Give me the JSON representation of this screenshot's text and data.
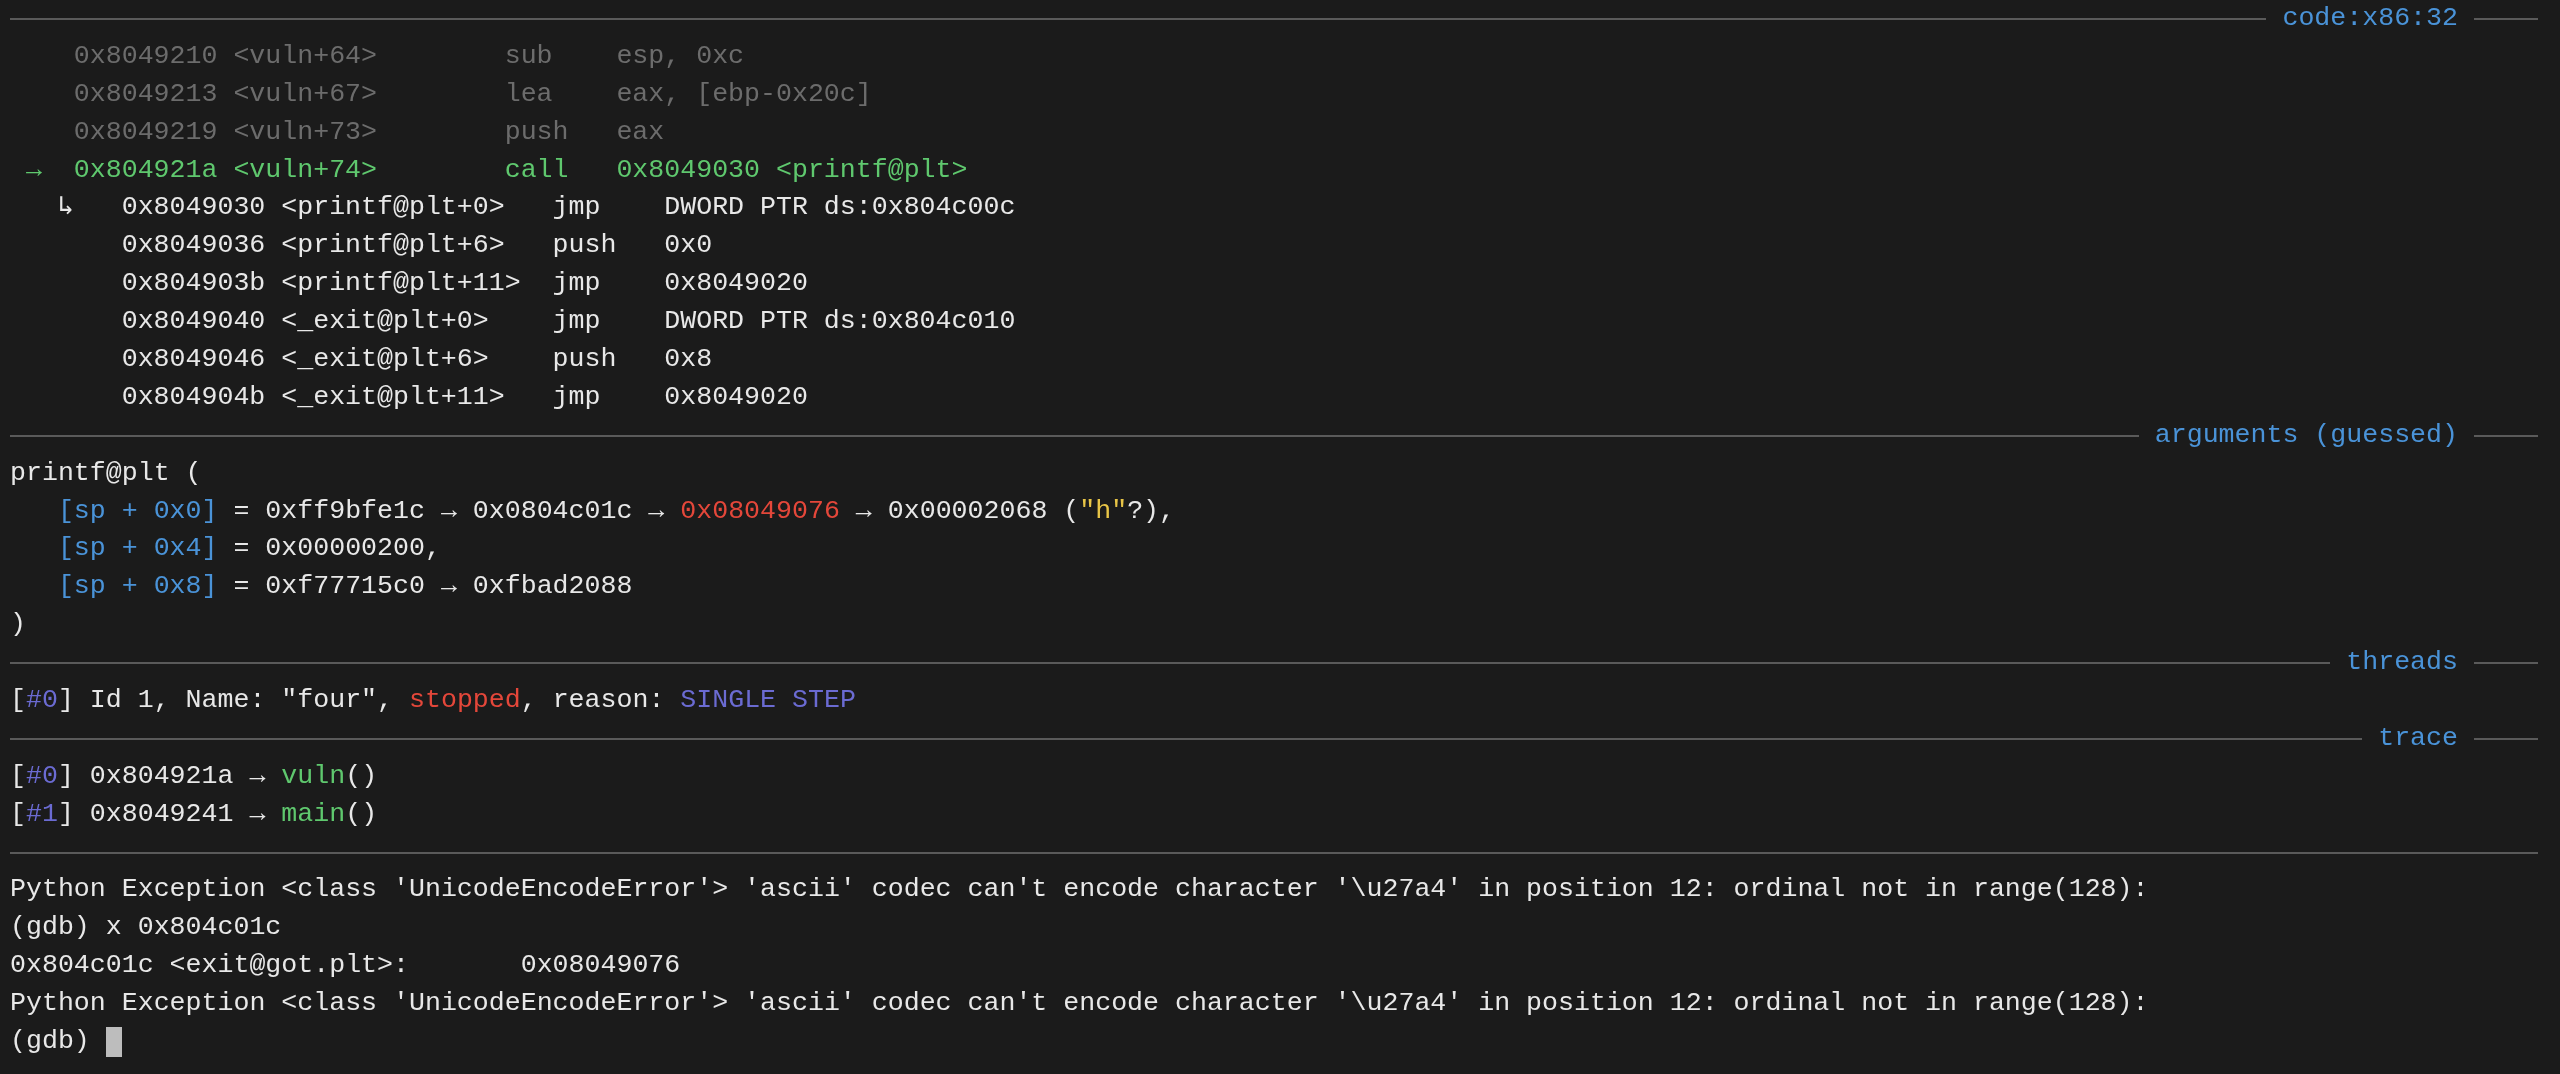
{
  "sections": [
    {
      "kind": "code",
      "title": "code:x86:32",
      "rows": [
        {
          "kind": "past",
          "address": "0x8049210",
          "symbol": "<vuln+64>",
          "mnemonic": "sub",
          "operands": "esp, 0xc"
        },
        {
          "kind": "past",
          "address": "0x8049213",
          "symbol": "<vuln+67>",
          "mnemonic": "lea",
          "operands": "eax, [ebp-0x20c]"
        },
        {
          "kind": "past",
          "address": "0x8049219",
          "symbol": "<vuln+73>",
          "mnemonic": "push",
          "operands": "eax"
        },
        {
          "kind": "current",
          "marker": "→",
          "address": "0x804921a",
          "symbol": "<vuln+74>",
          "mnemonic": "call",
          "operands": "0x8049030 <printf@plt>"
        },
        {
          "kind": "target",
          "marker": "↳",
          "address": "0x8049030",
          "symbol": "<printf@plt+0>",
          "mnemonic": "jmp",
          "operands": "DWORD PTR ds:0x804c00c"
        },
        {
          "kind": "target",
          "address": "0x8049036",
          "symbol": "<printf@plt+6>",
          "mnemonic": "push",
          "operands": "0x0"
        },
        {
          "kind": "target",
          "address": "0x804903b",
          "symbol": "<printf@plt+11>",
          "mnemonic": "jmp",
          "operands": "0x8049020"
        },
        {
          "kind": "target",
          "address": "0x8049040",
          "symbol": "<_exit@plt+0>",
          "mnemonic": "jmp",
          "operands": "DWORD PTR ds:0x804c010"
        },
        {
          "kind": "target",
          "address": "0x8049046",
          "symbol": "<_exit@plt+6>",
          "mnemonic": "push",
          "operands": "0x8"
        },
        {
          "kind": "target",
          "address": "0x804904b",
          "symbol": "<_exit@plt+11>",
          "mnemonic": "jmp",
          "operands": "0x8049020"
        }
      ]
    },
    {
      "kind": "lines",
      "title": "arguments (guessed)",
      "lines": [
        {
          "kind": "call",
          "segments": [
            {
              "text": "printf@plt (",
              "kind": "plain"
            }
          ]
        },
        {
          "kind": "arg",
          "segments": [
            {
              "text": "[sp + 0x0]",
              "kind": "blue"
            },
            {
              "text": " = 0xff9bfe1c → 0x0804c01c → ",
              "kind": "plain"
            },
            {
              "text": "0x08049076",
              "kind": "red"
            },
            {
              "text": " → 0x00002068 (",
              "kind": "plain"
            },
            {
              "text": "\"h\"",
              "kind": "yellow"
            },
            {
              "text": "?),",
              "kind": "plain"
            }
          ]
        },
        {
          "kind": "arg",
          "segments": [
            {
              "text": "[sp + 0x4]",
              "kind": "blue"
            },
            {
              "text": " = 0x00000200,",
              "kind": "plain"
            }
          ]
        },
        {
          "kind": "arg",
          "segments": [
            {
              "text": "[sp + 0x8]",
              "kind": "blue"
            },
            {
              "text": " = 0xf77715c0 → 0xfbad2088",
              "kind": "plain"
            }
          ]
        },
        {
          "kind": "call",
          "segments": [
            {
              "text": ")",
              "kind": "plain"
            }
          ]
        }
      ]
    },
    {
      "kind": "lines",
      "title": "threads",
      "lines": [
        {
          "kind": "thread",
          "segments": [
            {
              "text": "[",
              "kind": "plain"
            },
            {
              "text": "#0",
              "kind": "purple"
            },
            {
              "text": "] Id 1, Name: \"four\", ",
              "kind": "plain"
            },
            {
              "text": "stopped",
              "kind": "red"
            },
            {
              "text": ", reason: ",
              "kind": "plain"
            },
            {
              "text": "SINGLE STEP",
              "kind": "purple"
            }
          ]
        }
      ]
    },
    {
      "kind": "lines",
      "title": "trace",
      "lines": [
        {
          "kind": "frame",
          "segments": [
            {
              "text": "[",
              "kind": "plain"
            },
            {
              "text": "#0",
              "kind": "purple"
            },
            {
              "text": "] 0x804921a → ",
              "kind": "plain"
            },
            {
              "text": "vuln",
              "kind": "green"
            },
            {
              "text": "()",
              "kind": "plain"
            }
          ]
        },
        {
          "kind": "frame",
          "segments": [
            {
              "text": "[",
              "kind": "plain"
            },
            {
              "text": "#1",
              "kind": "purple"
            },
            {
              "text": "] 0x8049241 → ",
              "kind": "plain"
            },
            {
              "text": "main",
              "kind": "green"
            },
            {
              "text": "()",
              "kind": "plain"
            }
          ]
        }
      ]
    },
    {
      "kind": "lines",
      "lines": [
        {
          "kind": "output",
          "segments": [
            {
              "text": "Python Exception <class 'UnicodeEncodeError'> 'ascii' codec can't encode character '\\u27a4' in position 12: ordinal not in range(128):",
              "kind": "plain"
            }
          ]
        },
        {
          "kind": "prompt",
          "segments": [
            {
              "text": "(gdb) x 0x804c01c",
              "kind": "plain"
            }
          ]
        },
        {
          "kind": "output",
          "segments": [
            {
              "text": "0x804c01c <exit@got.plt>:\t0x08049076",
              "kind": "plain"
            }
          ]
        },
        {
          "kind": "output",
          "segments": [
            {
              "text": "Python Exception <class 'UnicodeEncodeError'> 'ascii' codec can't encode character '\\u27a4' in position 12: ordinal not in range(128):",
              "kind": "plain"
            }
          ]
        },
        {
          "kind": "prompt",
          "cursor": true,
          "segments": [
            {
              "text": "(gdb)",
              "kind": "plain"
            }
          ]
        }
      ]
    }
  ]
}
